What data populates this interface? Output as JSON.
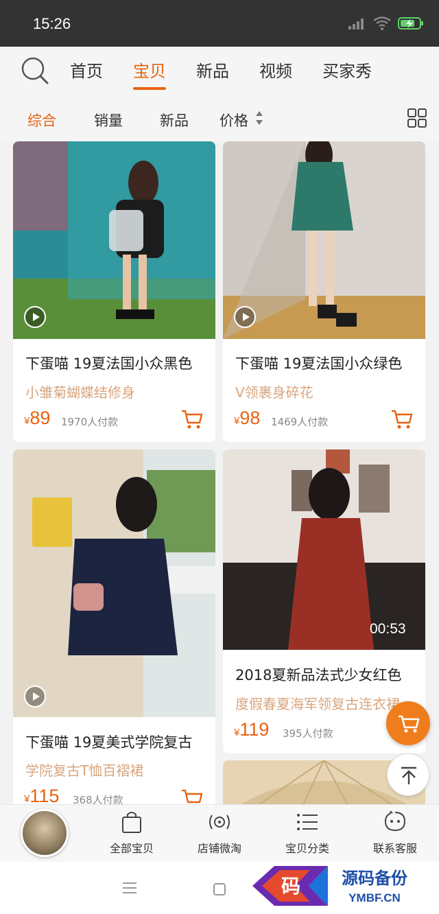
{
  "status_bar": {
    "time": "15:26",
    "icons": [
      "signal-icon",
      "wifi-icon",
      "battery-charging-icon"
    ]
  },
  "top_nav": {
    "tabs": [
      {
        "label": "首页",
        "active": false
      },
      {
        "label": "宝贝",
        "active": true
      },
      {
        "label": "新品",
        "active": false
      },
      {
        "label": "视频",
        "active": false
      },
      {
        "label": "买家秀",
        "active": false
      }
    ]
  },
  "sort_bar": {
    "options": [
      "综合",
      "销量",
      "新品",
      "价格"
    ],
    "active": "综合"
  },
  "colors": {
    "accent": "#e8620f",
    "subtitle": "#d9a57e",
    "status_bar": "#333333"
  },
  "products": [
    {
      "title": "下蛋喵 19夏法国小众黑色",
      "subtitle": "小雏菊蝴蝶结修身",
      "currency": "¥",
      "price": "89",
      "paid": "1970人付款",
      "has_video": true
    },
    {
      "title": "下蛋喵 19夏法国小众绿色",
      "subtitle": "V领裹身碎花",
      "currency": "¥",
      "price": "98",
      "paid": "1469人付款",
      "has_video": true
    },
    {
      "title": "下蛋喵 19夏美式学院复古",
      "subtitle": "学院复古T恤百褶裙",
      "currency": "¥",
      "price": "115",
      "paid": "368人付款",
      "has_video": true
    },
    {
      "title": "2018夏新品法式少女红色",
      "subtitle": "度假春夏海军领复古连衣裙",
      "currency": "¥",
      "price": "119",
      "paid": "395人付款",
      "duration": "00:53"
    }
  ],
  "shop_bar": {
    "items": [
      {
        "label": "全部宝贝",
        "icon": "shopping-bag-icon"
      },
      {
        "label": "店铺微淘",
        "icon": "broadcast-icon"
      },
      {
        "label": "宝贝分类",
        "icon": "list-icon"
      },
      {
        "label": "联系客服",
        "icon": "chat-bubble-icon"
      }
    ]
  },
  "watermark": {
    "mark": "码",
    "text": "源码备份",
    "domain": "YMBF.CN"
  }
}
